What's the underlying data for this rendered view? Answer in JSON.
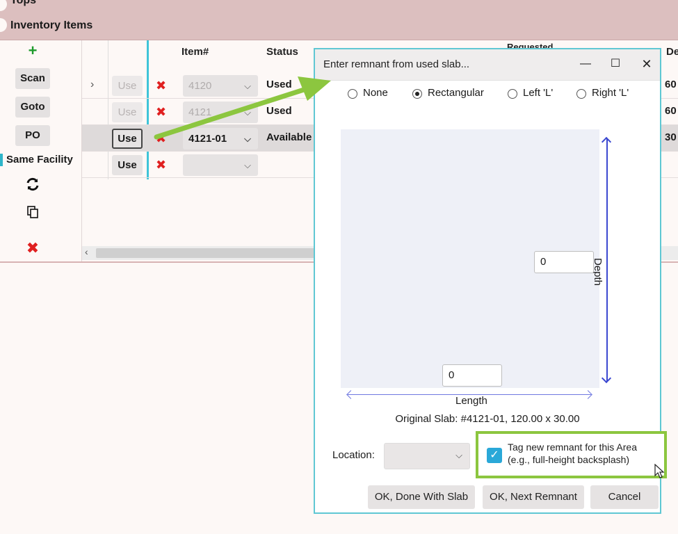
{
  "sections": {
    "tops": "Tops",
    "inventory": "Inventory Items"
  },
  "left_panel": {
    "add_icon": "plus-icon",
    "scan": "Scan",
    "goto": "Goto",
    "po": "PO",
    "same_facility": "Same Facility",
    "refresh_icon": "refresh-icon",
    "copy_icon": "copy-icon",
    "delete_icon": "delete-icon"
  },
  "table": {
    "headers": {
      "item": "Item#",
      "status": "Status",
      "requested": "Requested",
      "de": "De"
    },
    "rows": [
      {
        "use": "Use",
        "item": "4120",
        "status": "Used",
        "right": "60"
      },
      {
        "use": "Use",
        "item": "4121",
        "status": "Used",
        "right": "60"
      },
      {
        "use": "Use",
        "item": "4121-01",
        "status": "Available",
        "right": "30"
      },
      {
        "use": "Use",
        "item": "",
        "status": "",
        "right": ""
      }
    ]
  },
  "dialog": {
    "title": "Enter remnant from used slab...",
    "radios": [
      "None",
      "Rectangular",
      "Left 'L'",
      "Right 'L'"
    ],
    "selected_radio": "Rectangular",
    "depth_label": "Depth",
    "length_label": "Length",
    "depth_value": "0",
    "length_value": "0",
    "original_slab": "Original Slab: #4121-01,  120.00 x 30.00",
    "location_label": "Location:",
    "location_value": "",
    "tag_line1": "Tag new remnant for this Area",
    "tag_line2": "(e.g., full-height backsplash)",
    "tag_checked": true,
    "buttons": {
      "done": "OK, Done With Slab",
      "next": "OK, Next Remnant",
      "cancel": "Cancel"
    }
  },
  "colors": {
    "header_bg": "#dcbfbf",
    "accent": "#3fc5d8",
    "highlight": "#8cc63f",
    "delete": "#e02020",
    "depth_arrow": "#3b48d0"
  }
}
